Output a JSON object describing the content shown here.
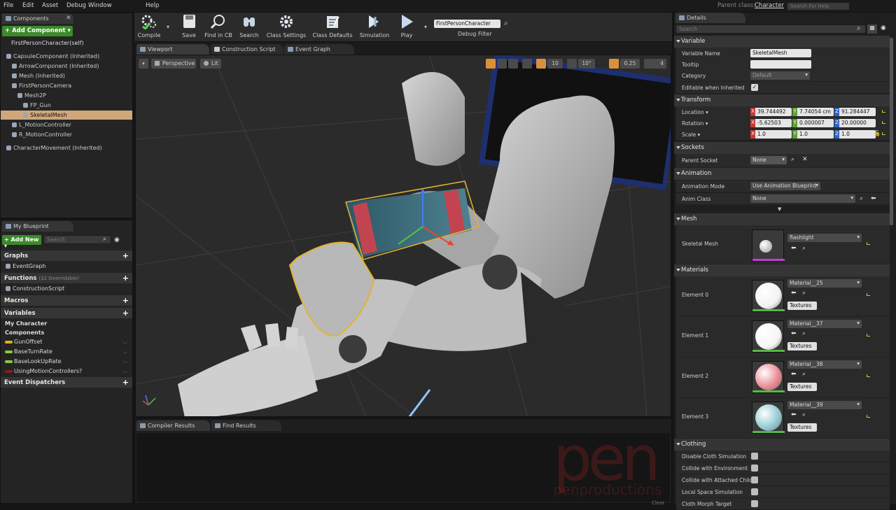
{
  "menubar": {
    "items": [
      "File",
      "Edit",
      "Asset",
      "Debug",
      "Window",
      "Help"
    ],
    "parent_class_label": "Parent class:",
    "parent_class_value": "Character",
    "help_search_placeholder": "Search For Help"
  },
  "components": {
    "tab": "Components",
    "add_button": "+ Add Component ▾",
    "self_label": "FirstPersonCharacter(self)",
    "tree": [
      {
        "label": "CapsuleComponent (Inherited)",
        "indent": 1
      },
      {
        "label": "ArrowComponent (Inherited)",
        "indent": 2
      },
      {
        "label": "Mesh (Inherited)",
        "indent": 2
      },
      {
        "label": "FirstPersonCamera",
        "indent": 2
      },
      {
        "label": "Mesh2P",
        "indent": 3
      },
      {
        "label": "FP_Gun",
        "indent": 4
      },
      {
        "label": "SkeletalMesh",
        "indent": 4
      },
      {
        "label": "L_MotionController",
        "indent": 2
      },
      {
        "label": "R_MotionController",
        "indent": 2
      },
      {
        "label": "CharacterMovement (Inherited)",
        "indent": 1
      }
    ]
  },
  "myblueprint": {
    "tab": "My Blueprint",
    "add_new": "+ Add New ▾",
    "search_placeholder": "Search",
    "graphs": "Graphs",
    "event_graph": "EventGraph",
    "functions": "Functions",
    "functions_count": "(32 Overridable)",
    "construction_script": "ConstructionScript",
    "macros": "Macros",
    "variables": "Variables",
    "my_character": "My Character",
    "components_label": "Components",
    "vars": [
      {
        "label": "GunOffset",
        "color": "#d9b229"
      },
      {
        "label": "BaseTurnRate",
        "color": "#8ec63f"
      },
      {
        "label": "BaseLookUpRate",
        "color": "#8ec63f"
      },
      {
        "label": "UsingMotionControllers?",
        "color": "#8c1c1c"
      }
    ],
    "event_dispatchers": "Event Dispatchers"
  },
  "toolbar": {
    "buttons": [
      "Compile",
      "Save",
      "Find in CB",
      "Search",
      "Class Settings",
      "Class Defaults",
      "Simulation",
      "Play"
    ],
    "debug_object": "FirstPersonCharacter",
    "debug_filter": "Debug Filter"
  },
  "editor_tabs": [
    "Viewport",
    "Construction Script",
    "Event Graph"
  ],
  "viewport": {
    "perspective": "Perspective",
    "lit": "Lit",
    "grid_snap": "10",
    "rot_snap": "10°",
    "scale_snap": "0.25",
    "cam_speed": "4"
  },
  "bottom_tabs": [
    "Compiler Results",
    "Find Results"
  ],
  "bottom_clear": "Clear",
  "details": {
    "tab": "Details",
    "search_placeholder": "Search",
    "variable": {
      "header": "Variable",
      "name_label": "Variable Name",
      "name_value": "SkeletalMesh",
      "tooltip_label": "Tooltip",
      "category_label": "Category",
      "category_value": "Default",
      "editable_label": "Editable when Inherited"
    },
    "transform": {
      "header": "Transform",
      "location_label": "Location ▾",
      "location": [
        "39.744492",
        "7.74054 cm",
        "91.284447"
      ],
      "rotation_label": "Rotation ▾",
      "rotation": [
        "-5.62503",
        "0.000007",
        "20.00000"
      ],
      "scale_label": "Scale ▾",
      "scale": [
        "1.0",
        "1.0",
        "1.0"
      ],
      "axes": [
        "X",
        "Y",
        "Z"
      ]
    },
    "sockets": {
      "header": "Sockets",
      "parent_label": "Parent Socket",
      "parent_value": "None"
    },
    "animation": {
      "header": "Animation",
      "mode_label": "Animation Mode",
      "mode_value": "Use Animation Blueprint",
      "class_label": "Anim Class",
      "class_value": "None"
    },
    "mesh": {
      "header": "Mesh",
      "label": "Skeletal Mesh",
      "value": "flashlight"
    },
    "materials": {
      "header": "Materials",
      "textures": "Textures",
      "elements": [
        {
          "label": "Element 0",
          "value": "Material__25",
          "color": "#f2f2f2"
        },
        {
          "label": "Element 1",
          "value": "Material__37",
          "color": "#f5f5f5"
        },
        {
          "label": "Element 2",
          "value": "Material__38",
          "color": "#e8848e"
        },
        {
          "label": "Element 3",
          "value": "Material__39",
          "color": "#8cc8d0"
        }
      ]
    },
    "clothing": {
      "header": "Clothing",
      "rows": [
        "Disable Cloth Simulation",
        "Collide with Environment",
        "Collide with Attached Child",
        "Local Space Simulation",
        "Cloth Morph Target"
      ]
    }
  },
  "watermark": {
    "logo": "pen",
    "text": "penproductions"
  }
}
